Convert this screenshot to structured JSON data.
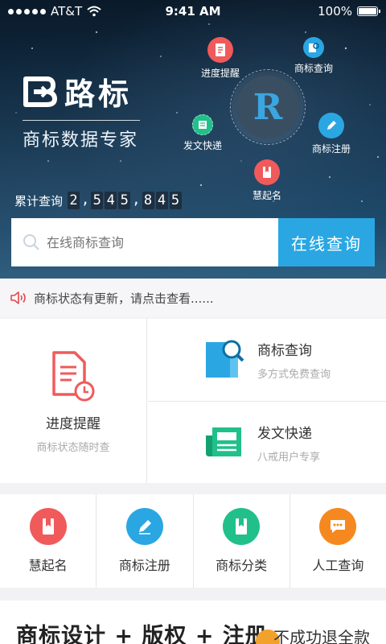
{
  "status_bar": {
    "carrier": "AT&T",
    "time": "9:41 AM",
    "battery": "100%"
  },
  "brand": {
    "name": "路标",
    "tagline": "商标数据专家"
  },
  "orbit": {
    "center_letter": "R",
    "items": [
      {
        "label": "进度提醒",
        "icon": "document-icon",
        "color": "#f05a5b"
      },
      {
        "label": "商标查询",
        "icon": "search-doc-icon",
        "color": "#2aa7e3"
      },
      {
        "label": "发文快递",
        "icon": "newspaper-icon",
        "color": "#21c08b"
      },
      {
        "label": "商标注册",
        "icon": "pen-icon",
        "color": "#2aa7e3"
      },
      {
        "label": "慧起名",
        "icon": "book-icon",
        "color": "#f05a5b"
      }
    ]
  },
  "counter": {
    "label": "累计查询",
    "value": "2,545,845"
  },
  "search": {
    "placeholder": "在线商标查询",
    "button": "在线查询"
  },
  "notice": {
    "text": "商标状态有更新，请点击查看......",
    "icon": "speaker-icon"
  },
  "features": {
    "big": {
      "title": "进度提醒",
      "subtitle": "商标状态随时查",
      "icon": "document-clock-icon",
      "color": "#f05a5b"
    },
    "rows": [
      {
        "title": "商标查询",
        "subtitle": "多方式免费查询",
        "icon": "search-doc-icon",
        "color": "#2aa7e3"
      },
      {
        "title": "发文快递",
        "subtitle": "八戒用户专享",
        "icon": "newspaper-icon",
        "color": "#21c08b"
      }
    ]
  },
  "quick": [
    {
      "label": "慧起名",
      "icon": "book-icon",
      "color": "#f05a5b"
    },
    {
      "label": "商标注册",
      "icon": "pen-icon",
      "color": "#2aa7e3"
    },
    {
      "label": "商标分类",
      "icon": "book-icon",
      "color": "#21c08b"
    },
    {
      "label": "人工查询",
      "icon": "chat-icon",
      "color": "#f5891f"
    }
  ],
  "banner": {
    "left_text": "商标设计 + 版权 + 注册",
    "right_text": "不成功退全款"
  }
}
